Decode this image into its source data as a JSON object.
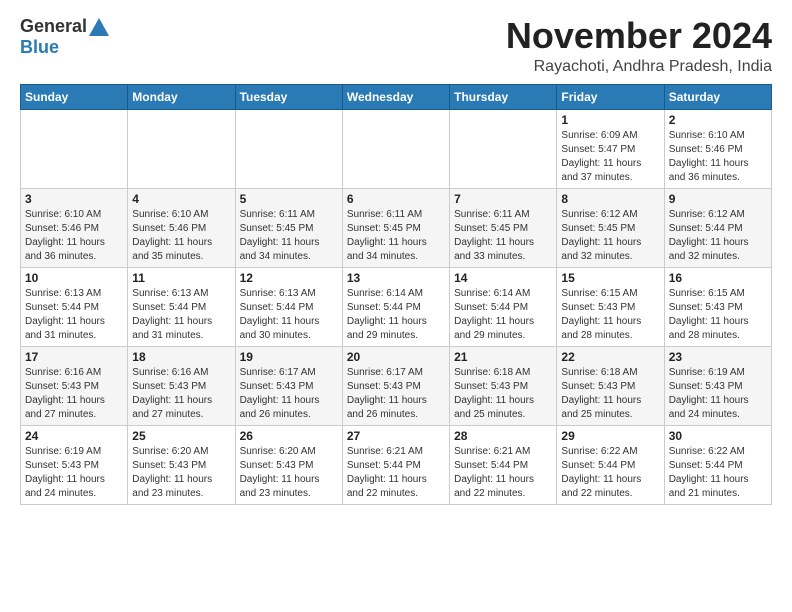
{
  "header": {
    "logo_general": "General",
    "logo_blue": "Blue",
    "title": "November 2024",
    "location": "Rayachoti, Andhra Pradesh, India"
  },
  "days_of_week": [
    "Sunday",
    "Monday",
    "Tuesday",
    "Wednesday",
    "Thursday",
    "Friday",
    "Saturday"
  ],
  "weeks": [
    [
      {
        "day": "",
        "info": ""
      },
      {
        "day": "",
        "info": ""
      },
      {
        "day": "",
        "info": ""
      },
      {
        "day": "",
        "info": ""
      },
      {
        "day": "",
        "info": ""
      },
      {
        "day": "1",
        "info": "Sunrise: 6:09 AM\nSunset: 5:47 PM\nDaylight: 11 hours\nand 37 minutes."
      },
      {
        "day": "2",
        "info": "Sunrise: 6:10 AM\nSunset: 5:46 PM\nDaylight: 11 hours\nand 36 minutes."
      }
    ],
    [
      {
        "day": "3",
        "info": "Sunrise: 6:10 AM\nSunset: 5:46 PM\nDaylight: 11 hours\nand 36 minutes."
      },
      {
        "day": "4",
        "info": "Sunrise: 6:10 AM\nSunset: 5:46 PM\nDaylight: 11 hours\nand 35 minutes."
      },
      {
        "day": "5",
        "info": "Sunrise: 6:11 AM\nSunset: 5:45 PM\nDaylight: 11 hours\nand 34 minutes."
      },
      {
        "day": "6",
        "info": "Sunrise: 6:11 AM\nSunset: 5:45 PM\nDaylight: 11 hours\nand 34 minutes."
      },
      {
        "day": "7",
        "info": "Sunrise: 6:11 AM\nSunset: 5:45 PM\nDaylight: 11 hours\nand 33 minutes."
      },
      {
        "day": "8",
        "info": "Sunrise: 6:12 AM\nSunset: 5:45 PM\nDaylight: 11 hours\nand 32 minutes."
      },
      {
        "day": "9",
        "info": "Sunrise: 6:12 AM\nSunset: 5:44 PM\nDaylight: 11 hours\nand 32 minutes."
      }
    ],
    [
      {
        "day": "10",
        "info": "Sunrise: 6:13 AM\nSunset: 5:44 PM\nDaylight: 11 hours\nand 31 minutes."
      },
      {
        "day": "11",
        "info": "Sunrise: 6:13 AM\nSunset: 5:44 PM\nDaylight: 11 hours\nand 31 minutes."
      },
      {
        "day": "12",
        "info": "Sunrise: 6:13 AM\nSunset: 5:44 PM\nDaylight: 11 hours\nand 30 minutes."
      },
      {
        "day": "13",
        "info": "Sunrise: 6:14 AM\nSunset: 5:44 PM\nDaylight: 11 hours\nand 29 minutes."
      },
      {
        "day": "14",
        "info": "Sunrise: 6:14 AM\nSunset: 5:44 PM\nDaylight: 11 hours\nand 29 minutes."
      },
      {
        "day": "15",
        "info": "Sunrise: 6:15 AM\nSunset: 5:43 PM\nDaylight: 11 hours\nand 28 minutes."
      },
      {
        "day": "16",
        "info": "Sunrise: 6:15 AM\nSunset: 5:43 PM\nDaylight: 11 hours\nand 28 minutes."
      }
    ],
    [
      {
        "day": "17",
        "info": "Sunrise: 6:16 AM\nSunset: 5:43 PM\nDaylight: 11 hours\nand 27 minutes."
      },
      {
        "day": "18",
        "info": "Sunrise: 6:16 AM\nSunset: 5:43 PM\nDaylight: 11 hours\nand 27 minutes."
      },
      {
        "day": "19",
        "info": "Sunrise: 6:17 AM\nSunset: 5:43 PM\nDaylight: 11 hours\nand 26 minutes."
      },
      {
        "day": "20",
        "info": "Sunrise: 6:17 AM\nSunset: 5:43 PM\nDaylight: 11 hours\nand 26 minutes."
      },
      {
        "day": "21",
        "info": "Sunrise: 6:18 AM\nSunset: 5:43 PM\nDaylight: 11 hours\nand 25 minutes."
      },
      {
        "day": "22",
        "info": "Sunrise: 6:18 AM\nSunset: 5:43 PM\nDaylight: 11 hours\nand 25 minutes."
      },
      {
        "day": "23",
        "info": "Sunrise: 6:19 AM\nSunset: 5:43 PM\nDaylight: 11 hours\nand 24 minutes."
      }
    ],
    [
      {
        "day": "24",
        "info": "Sunrise: 6:19 AM\nSunset: 5:43 PM\nDaylight: 11 hours\nand 24 minutes."
      },
      {
        "day": "25",
        "info": "Sunrise: 6:20 AM\nSunset: 5:43 PM\nDaylight: 11 hours\nand 23 minutes."
      },
      {
        "day": "26",
        "info": "Sunrise: 6:20 AM\nSunset: 5:43 PM\nDaylight: 11 hours\nand 23 minutes."
      },
      {
        "day": "27",
        "info": "Sunrise: 6:21 AM\nSunset: 5:44 PM\nDaylight: 11 hours\nand 22 minutes."
      },
      {
        "day": "28",
        "info": "Sunrise: 6:21 AM\nSunset: 5:44 PM\nDaylight: 11 hours\nand 22 minutes."
      },
      {
        "day": "29",
        "info": "Sunrise: 6:22 AM\nSunset: 5:44 PM\nDaylight: 11 hours\nand 22 minutes."
      },
      {
        "day": "30",
        "info": "Sunrise: 6:22 AM\nSunset: 5:44 PM\nDaylight: 11 hours\nand 21 minutes."
      }
    ]
  ]
}
